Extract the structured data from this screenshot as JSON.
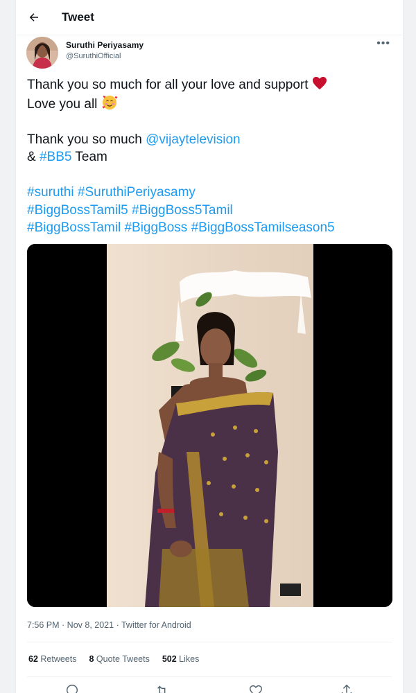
{
  "header": {
    "title": "Tweet"
  },
  "author": {
    "name": "Suruthi Periyasamy",
    "handle": "@SuruthiOfficial"
  },
  "tweet": {
    "l1": "Thank you so much for all your love and support ",
    "l2": "Love you all ",
    "l3_text": "Thank you so much ",
    "l3_link": "@vijaytelevision",
    "l4_pre": "& ",
    "l4_link": "#BB5",
    "l4_post": " Team",
    "hashtags_line1": [
      "#suruthi",
      "#SuruthiPeriyasamy"
    ],
    "hashtags_line2": [
      "#BiggBossTamil5",
      "#BiggBoss5Tamil"
    ],
    "hashtags_line3": [
      "#BiggBossTamil",
      "#BiggBoss",
      "#BiggBossTamilseason5"
    ]
  },
  "meta": {
    "time": "7:56 PM",
    "date": "Nov 8, 2021",
    "source": "Twitter for Android",
    "sep": " · "
  },
  "stats": {
    "retweets_count": "62",
    "retweets_label": " Retweets",
    "quotes_count": "8",
    "quotes_label": " Quote Tweets",
    "likes_count": "502",
    "likes_label": " Likes"
  },
  "colors": {
    "link": "#1d9bf0",
    "text": "#0f1419",
    "muted": "#536471",
    "heart": "#c8102e"
  },
  "icons": [
    "back-arrow-icon",
    "more-options-icon",
    "red-heart-emoji-icon",
    "smiling-face-with-hearts-emoji-icon",
    "reply-icon",
    "retweet-icon",
    "like-icon",
    "share-icon"
  ]
}
